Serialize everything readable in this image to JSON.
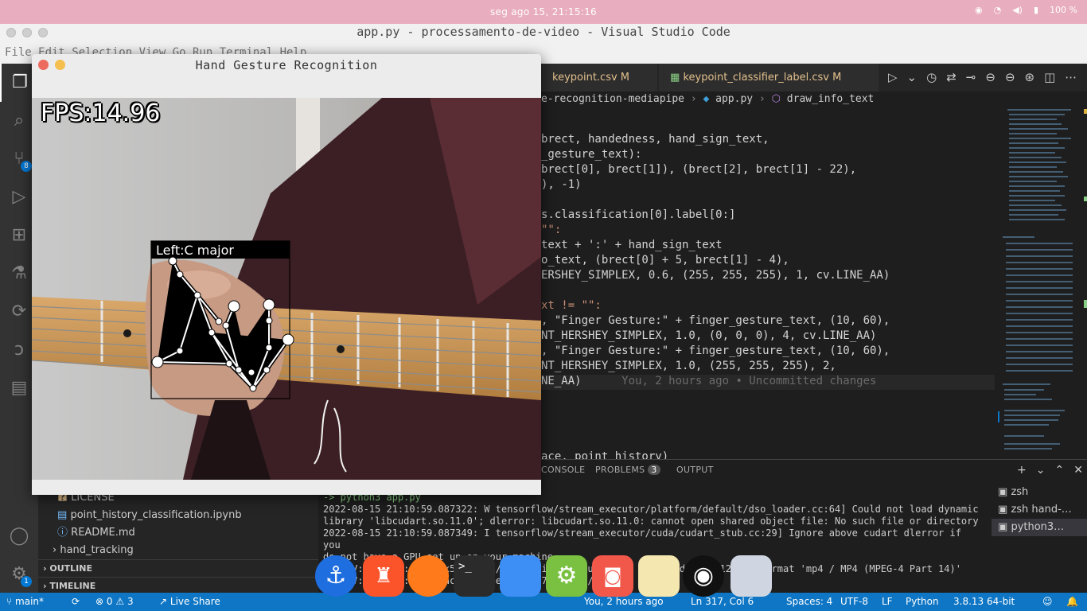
{
  "menubar": {
    "clock": "seg ago 15, 21:15:16",
    "battery": "100 %"
  },
  "vscode": {
    "title": "app.py - processamento-de-video - Visual Studio Code",
    "menu": "File Edit Selection View Go Run Terminal Help",
    "tabs": [
      {
        "label": "keypoint.csv",
        "status": "M"
      },
      {
        "label": "keypoint_classifier_label.csv",
        "status": "M"
      }
    ],
    "breadcrumb": {
      "folder": "e-recognition-mediapipe",
      "file": "app.py",
      "symbol": "draw_info_text"
    },
    "code_lines": [
      "brect, handedness, hand_sign_text,",
      "_gesture_text):",
      "brect[0], brect[1]), (brect[2], brect[1] - 22),",
      "), -1)",
      "",
      "s.classification[0].label[0:]",
      "\"\":",
      "text + ':' + hand_sign_text",
      "o_text, (brect[0] + 5, brect[1] - 4),",
      "ERSHEY_SIMPLEX, 0.6, (255, 255, 255), 1, cv.LINE_AA)",
      "",
      "xt != \"\":",
      ", \"Finger Gesture:\" + finger_gesture_text, (10, 60),",
      "NT_HERSHEY_SIMPLEX, 1.0, (0, 0, 0), 4, cv.LINE_AA)",
      ", \"Finger Gesture:\" + finger_gesture_text, (10, 60),",
      "NT_HERSHEY_SIMPLEX, 1.0, (255, 255, 255), 2,",
      "NE_AA)"
    ],
    "blame": "You, 2 hours ago • Uncommitted changes",
    "code_partial_bottom": "ace, point_history)"
  },
  "sidebar": {
    "files": [
      "LICENSE",
      "point_history_classification.ipynb",
      "README.md"
    ],
    "folder": "hand_tracking",
    "sections": [
      "OUTLINE",
      "TIMELINE"
    ]
  },
  "panel": {
    "tabs": [
      "CONSOLE",
      "PROBLEMS",
      "OUTPUT"
    ],
    "problems_count": "3",
    "terminal_lines": [
      "-> python3 app.py",
      "2022-08-15 21:10:59.087322: W tensorflow/stream_executor/platform/default/dso_loader.cc:64] Could not load dynamic",
      "library 'libcudart.so.11.0'; dlerror: libcudart.so.11.0: cannot open shared object file: No such file or directory",
      "2022-08-15 21:10:59.087349: I tensorflow/stream_executor/cuda/cudart_stub.cc:29] Ignore above cudart dlerror if you",
      " do not have a GPU set up on your machine.",
      "OpenCV: FFMPEG: tag 0x5634504d/'MP4V' is not supported with codec id 12 and format 'mp4 / MP4 (MPEG-4 Part 14)'",
      "OpenCV: FFMPEG: fallback to use tag 0x7634706d/'mp4v'"
    ],
    "terminals": [
      "zsh",
      "zsh hand-…",
      "python3…"
    ]
  },
  "status": {
    "branch": "main*",
    "errors": "0",
    "warnings": "3",
    "live_share": "Live Share",
    "blame": "You, 2 hours ago",
    "position": "Ln 317, Col 6",
    "spaces": "Spaces: 4",
    "encoding": "UTF-8",
    "eol": "LF",
    "language": "Python",
    "version": "3.8.13 64-bit"
  },
  "gesture_window": {
    "title": "Hand Gesture Recognition",
    "fps": "FPS:14.96",
    "label": "Left:C major"
  },
  "colors": {
    "accent": "#0e76c5",
    "menubar": "#e8adbf",
    "editor_bg": "#1e1e1e"
  }
}
